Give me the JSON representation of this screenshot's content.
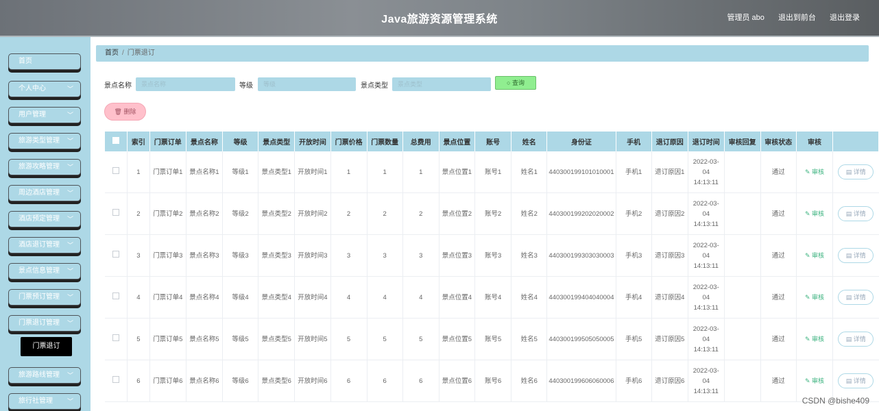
{
  "header": {
    "title": "Java旅游资源管理系统",
    "admin": "管理员 abo",
    "to_front": "退出到前台",
    "logout": "退出登录"
  },
  "sidebar": {
    "items": [
      {
        "label": "首页",
        "has_chevron": false
      },
      {
        "label": "个人中心",
        "has_chevron": true
      },
      {
        "label": "用户管理",
        "has_chevron": true
      },
      {
        "label": "旅游类型管理",
        "has_chevron": true
      },
      {
        "label": "旅游攻略管理",
        "has_chevron": true
      },
      {
        "label": "周边酒店管理",
        "has_chevron": true
      },
      {
        "label": "酒店预定管理",
        "has_chevron": true
      },
      {
        "label": "酒店退订管理",
        "has_chevron": true
      },
      {
        "label": "景点信息管理",
        "has_chevron": true
      },
      {
        "label": "门票预订管理",
        "has_chevron": true
      },
      {
        "label": "门票退订管理",
        "has_chevron": true
      },
      {
        "label": "旅游路线管理",
        "has_chevron": true
      },
      {
        "label": "旅行社管理",
        "has_chevron": true
      }
    ],
    "active_sub": "门票退订"
  },
  "breadcrumb": {
    "home": "首页",
    "sep": "/",
    "current": "门票退订"
  },
  "search": {
    "name_label": "景点名称",
    "name_placeholder": "景点名称",
    "level_label": "等级",
    "level_placeholder": "等级",
    "type_label": "景点类型",
    "type_placeholder": "景点类型",
    "button": "查询"
  },
  "actions": {
    "delete": "删除"
  },
  "table": {
    "headers": [
      "索引",
      "门票订单",
      "景点名称",
      "等级",
      "景点类型",
      "开放时间",
      "门票价格",
      "门票数量",
      "总费用",
      "景点位置",
      "账号",
      "姓名",
      "身份证",
      "手机",
      "退订原因",
      "退订时间",
      "审核回复",
      "审核状态",
      "审核",
      ""
    ],
    "audit_label": "审核",
    "detail_label": "详情",
    "rows": [
      {
        "index": "1",
        "order": "门票订单1",
        "name": "景点名称1",
        "level": "等级1",
        "type": "景点类型1",
        "open": "开放时间1",
        "price": "1",
        "qty": "1",
        "total": "1",
        "loc": "景点位置1",
        "acct": "账号1",
        "uname": "姓名1",
        "id": "440300199101010001",
        "phone": "手机1",
        "reason": "退订原因1",
        "time": "2022-03-04 14:13:11",
        "reply": "",
        "status": "通过"
      },
      {
        "index": "2",
        "order": "门票订单2",
        "name": "景点名称2",
        "level": "等级2",
        "type": "景点类型2",
        "open": "开放时间2",
        "price": "2",
        "qty": "2",
        "total": "2",
        "loc": "景点位置2",
        "acct": "账号2",
        "uname": "姓名2",
        "id": "440300199202020002",
        "phone": "手机2",
        "reason": "退订原因2",
        "time": "2022-03-04 14:13:11",
        "reply": "",
        "status": "通过"
      },
      {
        "index": "3",
        "order": "门票订单3",
        "name": "景点名称3",
        "level": "等级3",
        "type": "景点类型3",
        "open": "开放时间3",
        "price": "3",
        "qty": "3",
        "total": "3",
        "loc": "景点位置3",
        "acct": "账号3",
        "uname": "姓名3",
        "id": "440300199303030003",
        "phone": "手机3",
        "reason": "退订原因3",
        "time": "2022-03-04 14:13:11",
        "reply": "",
        "status": "通过"
      },
      {
        "index": "4",
        "order": "门票订单4",
        "name": "景点名称4",
        "level": "等级4",
        "type": "景点类型4",
        "open": "开放时间4",
        "price": "4",
        "qty": "4",
        "total": "4",
        "loc": "景点位置4",
        "acct": "账号4",
        "uname": "姓名4",
        "id": "440300199404040004",
        "phone": "手机4",
        "reason": "退订原因4",
        "time": "2022-03-04 14:13:11",
        "reply": "",
        "status": "通过"
      },
      {
        "index": "5",
        "order": "门票订单5",
        "name": "景点名称5",
        "level": "等级5",
        "type": "景点类型5",
        "open": "开放时间5",
        "price": "5",
        "qty": "5",
        "total": "5",
        "loc": "景点位置5",
        "acct": "账号5",
        "uname": "姓名5",
        "id": "440300199505050005",
        "phone": "手机5",
        "reason": "退订原因5",
        "time": "2022-03-04 14:13:11",
        "reply": "",
        "status": "通过"
      },
      {
        "index": "6",
        "order": "门票订单6",
        "name": "景点名称6",
        "level": "等级6",
        "type": "景点类型6",
        "open": "开放时间6",
        "price": "6",
        "qty": "6",
        "total": "6",
        "loc": "景点位置6",
        "acct": "账号6",
        "uname": "姓名6",
        "id": "440300199606060006",
        "phone": "手机6",
        "reason": "退订原因6",
        "time": "2022-03-04 14:13:11",
        "reply": "",
        "status": "通过"
      }
    ]
  },
  "watermark": "CSDN @bishe409"
}
